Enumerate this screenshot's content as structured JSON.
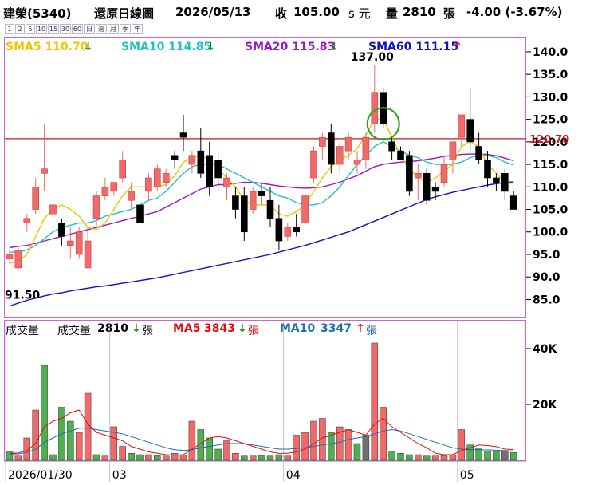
{
  "header": {
    "stock": "建榮(5340)",
    "chart_name": "還原日線圖",
    "date": "2026/05/13",
    "close_label": "收",
    "close_value": "105.00",
    "close_unit": "s 元",
    "volume_label": "量",
    "volume_value": "2810",
    "volume_unit": "張",
    "change": "-4.00 (-3.67%)"
  },
  "interval_buttons": [
    "1",
    "2",
    "5",
    "10",
    "15",
    "30",
    "60",
    "日",
    "週",
    "月",
    "季",
    "年"
  ],
  "price_legend": [
    {
      "label": "SMA5",
      "value": "110.70",
      "dir": "down",
      "color": "#f0c400"
    },
    {
      "label": "SMA10",
      "value": "114.85",
      "dir": "down",
      "color": "#22c2c2"
    },
    {
      "label": "SMA20",
      "value": "115.83",
      "dir": "down",
      "color": "#9a16c8"
    },
    {
      "label": "SMA60",
      "value": "111.15",
      "dir": "up",
      "color": "#1010c8"
    }
  ],
  "volume_legend": {
    "title": "成交量",
    "vol_label": "成交量",
    "vol_value": "2810",
    "vol_dir": "down",
    "vol_unit": "張",
    "ma5_label": "MA5",
    "ma5_value": "3843",
    "ma5_dir": "down",
    "ma5_unit": "張",
    "ma10_label": "MA10",
    "ma10_value": "3347",
    "ma10_dir": "up",
    "ma10_unit": "張"
  },
  "colors": {
    "up": "#f06a6a",
    "down": "#000000",
    "vol_up": "#f06a6a",
    "vol_down": "#4fae4f",
    "vol_flat": "#707070",
    "hline": "#d01010",
    "circle": "#2aa82a",
    "axis": "#000000",
    "frame": "#cc66cc"
  },
  "chart_data": [
    {
      "type": "candlestick",
      "ylim": [
        81,
        143
      ],
      "y_ticks": [
        85,
        90,
        95,
        100,
        105,
        110,
        115,
        120,
        125,
        130,
        135,
        140
      ],
      "x_labels": [
        {
          "index": 0,
          "label": "2026/01/30"
        },
        {
          "index": 12,
          "label": "03"
        },
        {
          "index": 32,
          "label": "04"
        },
        {
          "index": 52,
          "label": "05"
        }
      ],
      "highlight_line": {
        "value": 120.7,
        "label": "120.70"
      },
      "annotations": [
        {
          "text": "137.00",
          "type": "max",
          "index": 42
        },
        {
          "text": "91.50",
          "type": "min",
          "index": 1
        }
      ],
      "circle_marker_index": 43,
      "ohlc": [
        [
          94,
          96,
          93,
          95
        ],
        [
          92,
          97,
          91.5,
          96
        ],
        [
          102,
          104,
          100,
          103
        ],
        [
          105,
          112,
          104,
          110
        ],
        [
          113,
          124,
          109,
          114
        ],
        [
          104,
          108,
          103,
          106
        ],
        [
          102,
          103,
          97,
          99
        ],
        [
          97,
          101,
          94,
          98
        ],
        [
          95,
          101,
          94,
          100
        ],
        [
          92,
          101,
          92,
          98
        ],
        [
          103,
          109,
          101,
          108
        ],
        [
          108,
          112,
          107,
          110
        ],
        [
          109,
          111,
          108,
          111
        ],
        [
          112,
          118,
          111,
          116
        ],
        [
          107,
          111,
          105,
          109
        ],
        [
          106,
          108,
          101,
          102
        ],
        [
          109,
          113,
          107,
          112
        ],
        [
          110,
          115,
          109,
          114
        ],
        [
          111,
          114,
          110,
          113
        ],
        [
          117,
          118,
          114,
          116
        ],
        [
          122,
          126,
          118,
          121
        ],
        [
          115,
          118,
          113,
          117
        ],
        [
          118,
          123,
          112,
          113
        ],
        [
          117,
          120,
          108,
          110
        ],
        [
          116,
          118,
          109,
          112
        ],
        [
          110,
          113,
          107,
          112
        ],
        [
          108,
          110,
          103,
          105
        ],
        [
          108,
          110,
          98,
          100
        ],
        [
          105,
          110,
          104,
          109
        ],
        [
          109,
          111,
          106,
          108
        ],
        [
          107,
          110,
          101,
          103
        ],
        [
          103,
          106,
          96,
          98
        ],
        [
          99,
          102,
          98,
          101
        ],
        [
          101,
          104,
          99,
          100
        ],
        [
          102,
          109,
          101,
          108
        ],
        [
          112,
          119,
          111,
          118
        ],
        [
          119,
          122,
          116,
          121
        ],
        [
          122,
          124,
          113,
          115
        ],
        [
          115,
          120,
          113,
          119
        ],
        [
          118,
          122,
          116,
          121
        ],
        [
          115,
          118,
          113,
          116
        ],
        [
          116,
          122,
          114,
          121
        ],
        [
          124,
          137,
          122,
          131
        ],
        [
          131,
          132,
          123,
          124
        ],
        [
          120,
          121,
          116,
          118
        ],
        [
          118,
          119,
          116,
          116
        ],
        [
          117,
          118,
          108,
          109
        ],
        [
          112,
          115,
          107,
          113
        ],
        [
          113,
          114,
          106,
          107
        ],
        [
          110,
          111,
          107,
          109
        ],
        [
          111,
          117,
          110,
          115
        ],
        [
          116,
          120,
          113,
          120
        ],
        [
          121,
          126,
          119,
          126
        ],
        [
          125,
          132,
          118,
          120
        ],
        [
          119,
          122,
          115,
          116
        ],
        [
          116,
          118,
          110,
          112
        ],
        [
          112,
          113,
          109,
          111
        ],
        [
          113,
          114,
          107,
          109
        ],
        [
          108,
          109,
          105,
          105
        ]
      ],
      "sma5": [
        93,
        93.5,
        95,
        99,
        103,
        105,
        106,
        105,
        103.5,
        101,
        100.5,
        102,
        105,
        108,
        110,
        110,
        110,
        110,
        110.5,
        112.5,
        115.5,
        116.5,
        117,
        116,
        114,
        112,
        110,
        107,
        106,
        106,
        106,
        104,
        103.5,
        104.5,
        106,
        109,
        112,
        114.5,
        116,
        117,
        118.5,
        121.5,
        125,
        125,
        121,
        117,
        114,
        112,
        111,
        112,
        113.5,
        115,
        119,
        120,
        119,
        115,
        113,
        111,
        110.7
      ],
      "sma10": [
        95.5,
        95.5,
        96,
        97,
        98.5,
        100,
        101,
        101.5,
        102,
        102,
        102.5,
        103.5,
        104,
        104.5,
        105,
        106,
        107,
        107.5,
        109,
        111,
        113,
        114.5,
        115,
        115,
        115,
        114,
        113,
        112,
        111,
        110,
        109,
        108,
        107.5,
        106.5,
        106,
        106,
        106.5,
        108,
        110,
        112.5,
        115,
        117,
        119,
        120,
        119,
        118,
        117,
        116.5,
        115.5,
        115,
        115,
        115,
        115.5,
        116.5,
        117,
        117,
        116.5,
        115.5,
        114.85
      ],
      "sma20": [
        96.5,
        96.8,
        97,
        97.5,
        98,
        98.5,
        99,
        99.5,
        100,
        100.5,
        101,
        101.5,
        102,
        102.5,
        103,
        103.5,
        104,
        104.5,
        105.5,
        106.5,
        107.5,
        108.5,
        109.5,
        110,
        110.5,
        110.5,
        110.8,
        111,
        111,
        110.8,
        110.5,
        110.2,
        110,
        109.8,
        109.7,
        109.8,
        110,
        110.5,
        111,
        111.8,
        112.5,
        113.5,
        114.5,
        115,
        115.3,
        115.5,
        115.6,
        115.8,
        116.1,
        116.4,
        116.8,
        117,
        117.2,
        117.3,
        117.3,
        117.2,
        116.9,
        116.4,
        115.83
      ],
      "sma60": [
        83.5,
        84.2,
        84.8,
        85.3,
        85.8,
        86.2,
        86.5,
        86.9,
        87.2,
        87.5,
        87.8,
        88,
        88.3,
        88.6,
        88.9,
        89.2,
        89.5,
        89.8,
        90.2,
        90.6,
        91,
        91.4,
        91.8,
        92.2,
        92.6,
        93,
        93.4,
        93.8,
        94.2,
        94.6,
        95,
        95.5,
        96,
        96.5,
        97,
        97.6,
        98.2,
        98.8,
        99.4,
        100,
        100.8,
        101.6,
        102.4,
        103.2,
        104,
        104.8,
        105.6,
        106.4,
        107.2,
        107.8,
        108.3,
        108.8,
        109.2,
        109.6,
        110,
        110.4,
        110.7,
        110.95,
        111.15
      ]
    },
    {
      "type": "bar",
      "ylim": [
        0,
        50000
      ],
      "y_ticks": [
        {
          "value": 20000,
          "label": "20K"
        },
        {
          "value": 40000,
          "label": "40K"
        }
      ],
      "volume": [
        3000,
        1500,
        8000,
        18000,
        34000,
        2000,
        19000,
        14000,
        10000,
        24000,
        2000,
        1500,
        12000,
        5000,
        2500,
        2000,
        2000,
        1600,
        1500,
        2500,
        1800,
        14000,
        11000,
        8000,
        4000,
        7000,
        2500,
        1500,
        1500,
        1700,
        1500,
        2000,
        1500,
        9000,
        10000,
        14000,
        15000,
        10000,
        12000,
        11000,
        6000,
        9000,
        42000,
        19000,
        3000,
        2500,
        2000,
        2000,
        1500,
        1500,
        1600,
        2000,
        11000,
        5500,
        4500,
        3200,
        3000,
        3500,
        2810
      ],
      "direction": [
        "d",
        "u",
        "u",
        "u",
        "d",
        "d",
        "d",
        "d",
        "u",
        "u",
        "d",
        "u",
        "u",
        "u",
        "d",
        "d",
        "u",
        "d",
        "u",
        "u",
        "u",
        "u",
        "d",
        "d",
        "d",
        "u",
        "u",
        "d",
        "u",
        "d",
        "d",
        "d",
        "u",
        "u",
        "u",
        "u",
        "u",
        "d",
        "u",
        "u",
        "d",
        "f",
        "u",
        "u",
        "d",
        "d",
        "d",
        "u",
        "d",
        "u",
        "u",
        "u",
        "u",
        "d",
        "d",
        "d",
        "d",
        "f",
        "d"
      ],
      "ma5": [
        2500,
        2600,
        3500,
        6000,
        12000,
        14000,
        15000,
        17000,
        18000,
        13000,
        10000,
        9000,
        8000,
        7000,
        5000,
        4000,
        3000,
        2500,
        2000,
        1800,
        2000,
        4000,
        6000,
        8000,
        8500,
        8000,
        7000,
        6000,
        5000,
        4000,
        3000,
        2500,
        2500,
        3000,
        4000,
        6000,
        8000,
        9000,
        10000,
        11000,
        10000,
        9000,
        13000,
        15000,
        12000,
        10000,
        8000,
        6000,
        4500,
        2500,
        2000,
        2000,
        3500,
        4500,
        5500,
        5300,
        4900,
        4000,
        3843
      ],
      "ma10": [
        2200,
        2300,
        2800,
        4000,
        6500,
        8000,
        9500,
        10500,
        11500,
        11500,
        11000,
        10500,
        10000,
        9500,
        8500,
        7500,
        6500,
        5500,
        4500,
        3800,
        3500,
        3800,
        4500,
        5000,
        5500,
        6000,
        6000,
        6000,
        5500,
        5000,
        4500,
        4000,
        4000,
        4200,
        4500,
        5000,
        5500,
        6000,
        6500,
        7500,
        8000,
        8500,
        9500,
        10500,
        11000,
        10500,
        9500,
        8500,
        7500,
        6500,
        5500,
        4500,
        4000,
        3800,
        3800,
        3700,
        3600,
        3500,
        3347
      ]
    }
  ]
}
